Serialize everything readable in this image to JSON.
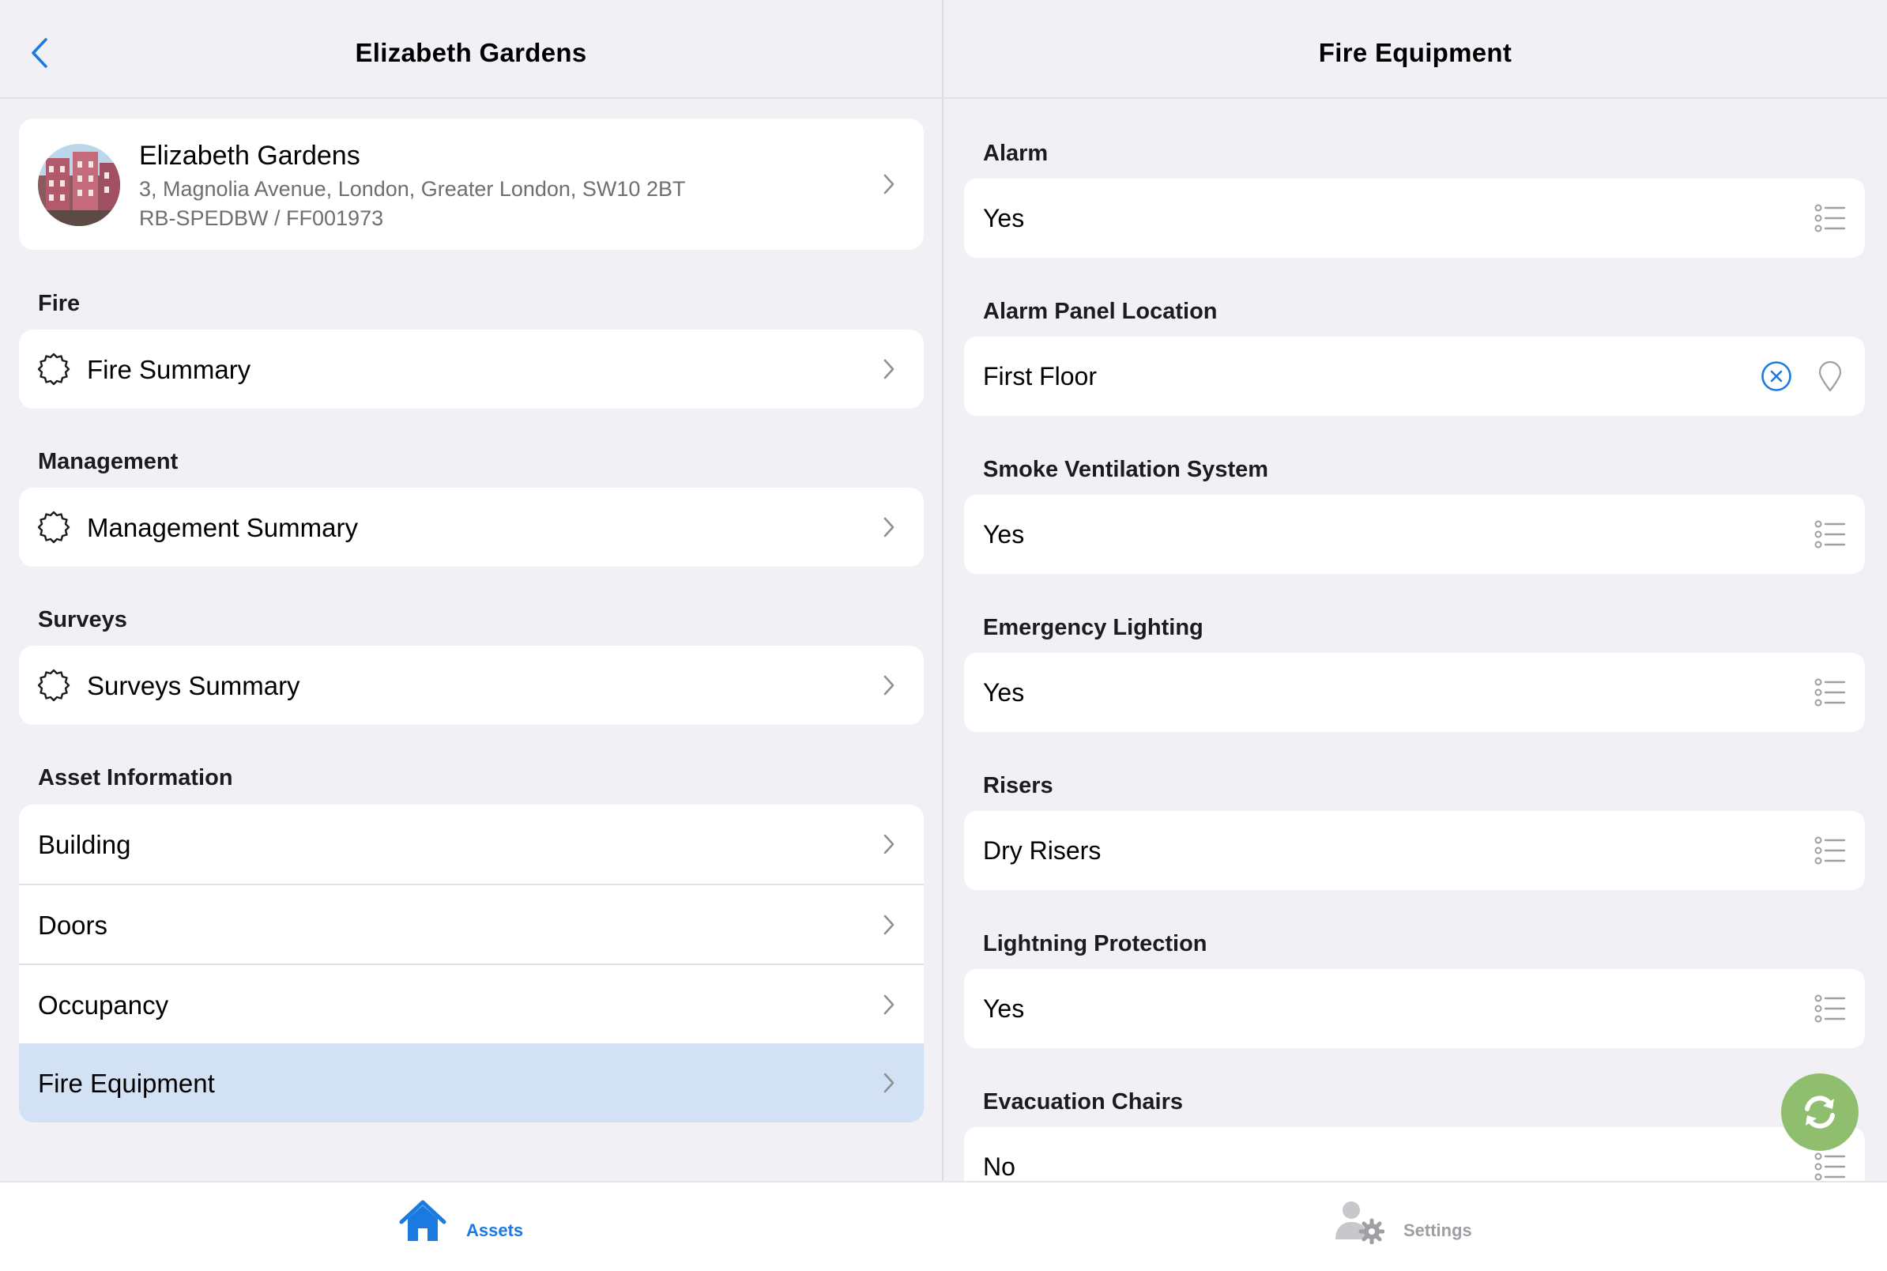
{
  "left_pane": {
    "title": "Elizabeth Gardens",
    "asset": {
      "name": "Elizabeth Gardens",
      "address": "3, Magnolia Avenue, London, Greater London, SW10 2BT",
      "reference": "RB-SPEDBW / FF001973"
    },
    "sections": {
      "fire": {
        "header": "Fire",
        "item": "Fire Summary"
      },
      "management": {
        "header": "Management",
        "item": "Management Summary"
      },
      "surveys": {
        "header": "Surveys",
        "item": "Surveys Summary"
      },
      "asset_info": {
        "header": "Asset Information",
        "items": [
          "Building",
          "Doors",
          "Occupancy",
          "Fire Equipment"
        ],
        "selected": "Fire Equipment"
      }
    }
  },
  "right_pane": {
    "title": "Fire Equipment",
    "fields": [
      {
        "label": "Alarm",
        "value": "Yes",
        "icon": "list-icon"
      },
      {
        "label": "Alarm Panel Location",
        "value": "First Floor",
        "icon": "location-pin-icon"
      },
      {
        "label": "Smoke Ventilation System",
        "value": "Yes",
        "icon": "list-icon"
      },
      {
        "label": "Emergency Lighting",
        "value": "Yes",
        "icon": "list-icon"
      },
      {
        "label": "Risers",
        "value": "Dry Risers",
        "icon": "list-icon"
      },
      {
        "label": "Lightning Protection",
        "value": "Yes",
        "icon": "list-icon"
      },
      {
        "label": "Evacuation Chairs",
        "value": "No",
        "icon": "list-icon"
      }
    ]
  },
  "tabbar": {
    "tabs": [
      {
        "label": "Assets",
        "icon": "house-icon",
        "active": true
      },
      {
        "label": "Settings",
        "icon": "user-gear-icon",
        "active": false
      }
    ]
  },
  "colors": {
    "accent": "#1a7ae0",
    "background": "#f0f0f5",
    "selected_row": "#d3e1f4",
    "sync_button": "#8fbe6e",
    "inactive_tab": "#9e9ea3"
  }
}
